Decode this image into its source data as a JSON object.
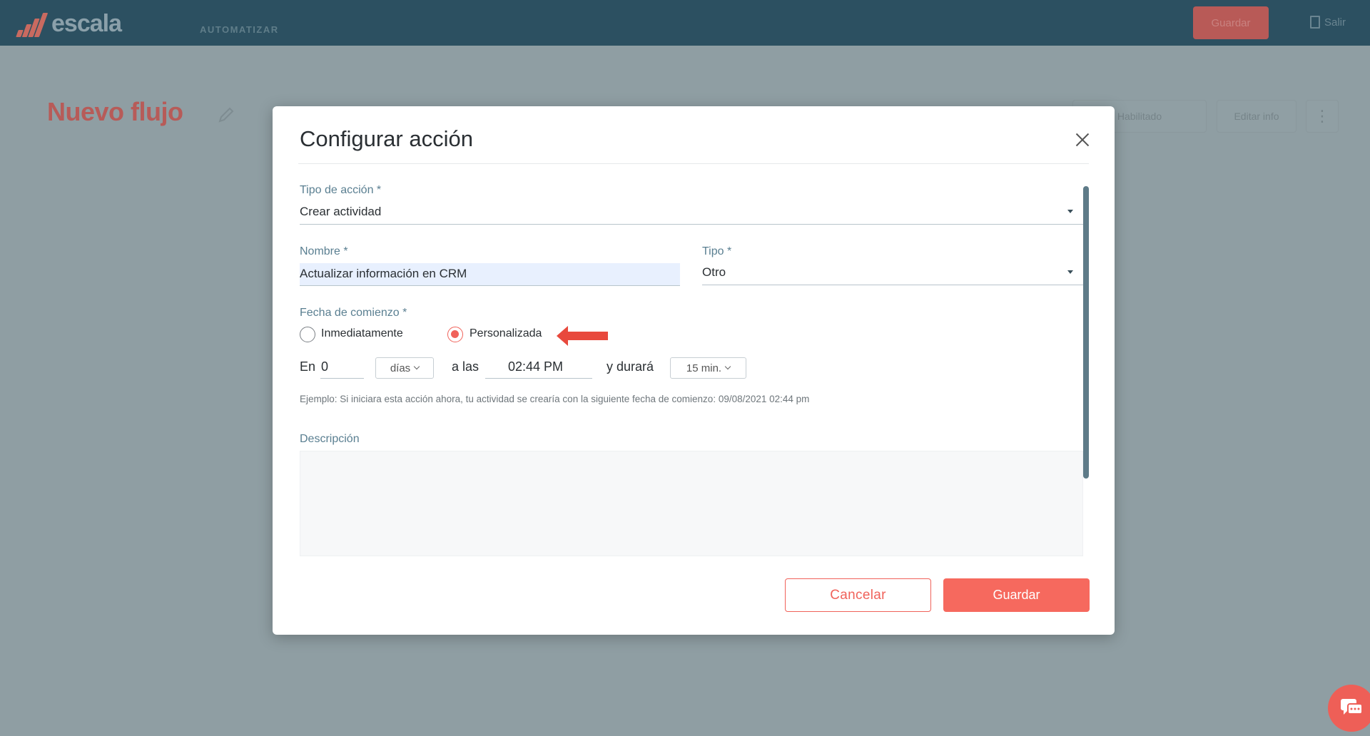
{
  "app": {
    "logo_text": "escala",
    "nav_item": "AUTOMATIZAR",
    "top_save_label": "Guardar",
    "top_exit_label": "Salir",
    "page_title": "Nuevo flujo",
    "bg_buttons": [
      "Habilitado",
      "Editar info"
    ]
  },
  "modal": {
    "title": "Configurar acción",
    "action_type": {
      "label": "Tipo de acción *",
      "value": "Crear actividad"
    },
    "name": {
      "label": "Nombre *",
      "value": "Actualizar información en CRM"
    },
    "type": {
      "label": "Tipo *",
      "value": "Otro"
    },
    "start_date": {
      "label": "Fecha de comienzo *",
      "options": [
        {
          "label": "Inmediatamente",
          "selected": false
        },
        {
          "label": "Personalizada",
          "selected": true
        }
      ]
    },
    "schedule": {
      "en_label": "En",
      "en_value": "0",
      "unit": "días",
      "at_label": "a las",
      "time": "02:44 PM",
      "duration_label": "y durará",
      "duration": "15 min."
    },
    "example": "Ejemplo: Si iniciara esta acción ahora, tu actividad se crearía con la siguiente fecha de comienzo: 09/08/2021 02:44 pm",
    "description": {
      "label": "Descripción",
      "value": ""
    },
    "cancel_label": "Cancelar",
    "save_label": "Guardar"
  },
  "colors": {
    "accent": "#f0625a",
    "topbar": "#2c5061",
    "label": "#5a7f91"
  }
}
